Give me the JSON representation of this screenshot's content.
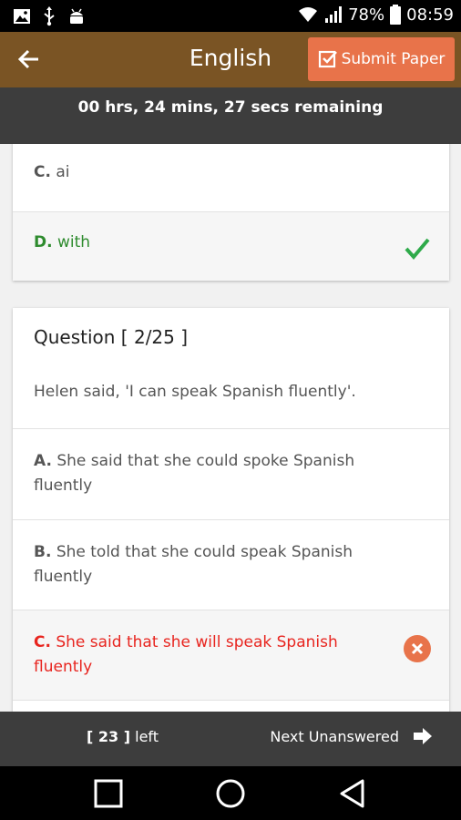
{
  "status_bar": {
    "battery": "78%",
    "time": "08:59"
  },
  "app_bar": {
    "title": "English",
    "submit_label": "Submit Paper"
  },
  "timer": {
    "text": "00 hrs, 24 mins, 27 secs remaining"
  },
  "previous_question": {
    "options": [
      {
        "letter": "C.",
        "text": "ai",
        "state": "normal"
      },
      {
        "letter": "D.",
        "text": "with",
        "state": "correct"
      }
    ]
  },
  "question": {
    "header": "Question [ 2/25 ]",
    "text": "Helen said, 'I can speak Spanish fluently'.",
    "options": [
      {
        "letter": "A.",
        "line1": "She said that she could spoke Spanish",
        "line2": "fluently",
        "state": "normal"
      },
      {
        "letter": "B.",
        "line1": "She told that she could speak Spanish",
        "line2": "fluently",
        "state": "normal"
      },
      {
        "letter": "C.",
        "line1": "She said that she will speak Spanish",
        "line2": "fluently",
        "state": "wrong"
      }
    ]
  },
  "bottom_bar": {
    "left_count": "[ 23 ]",
    "left_suffix": "left",
    "next_label": "Next Unanswered"
  },
  "colors": {
    "app_bar": "#7a5424",
    "submit": "#e8734a",
    "correct": "#2e8b2e",
    "wrong": "#e8251f"
  }
}
